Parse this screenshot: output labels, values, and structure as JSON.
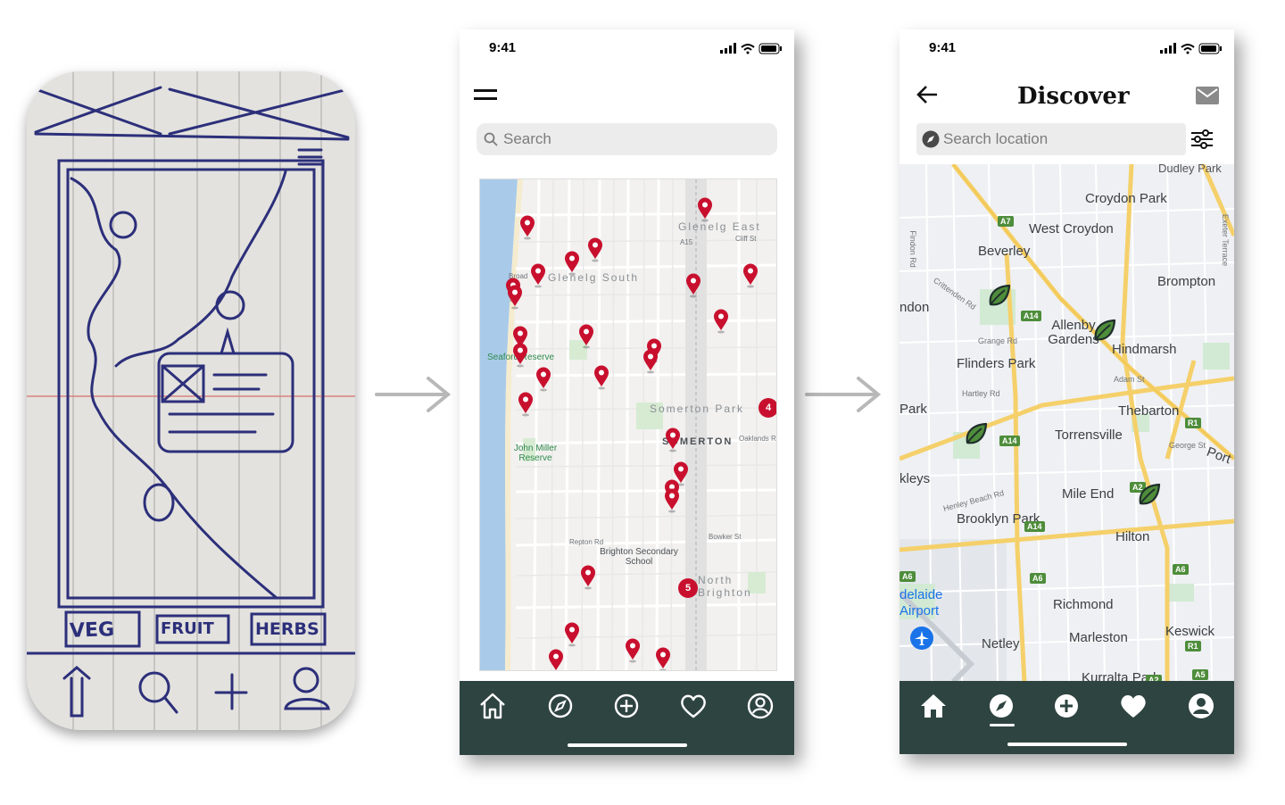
{
  "sketch": {
    "tabs": [
      "VEG",
      "FRUIT",
      "HERBS"
    ]
  },
  "phone2": {
    "status_time": "9:41",
    "search_placeholder": "Search",
    "map_labels": {
      "glenelg_east": "Glenelg East",
      "glenelg_south": "Glenelg South",
      "somerton_park": "Somerton Park",
      "somerton": "SOMERTON",
      "north_brighton": "North Brighton",
      "seaford_reserve": "Seaford Reserve",
      "john_miller_reserve": "John Miller Reserve",
      "brighton_school": "Brighton Secondary School",
      "cliff_st": "Cliff St",
      "oaklands_rd": "Oaklands Rd",
      "bowker_st": "Bowker St",
      "repton_rd": "Repton Rd",
      "broad": "Broad",
      "a15": "A15"
    },
    "clusters": [
      "4",
      "5"
    ],
    "tabs": [
      "home-icon",
      "compass-icon",
      "add-icon",
      "heart-icon",
      "profile-icon"
    ],
    "colors": {
      "pin": "#c8102e",
      "tabbar": "#2e4440"
    }
  },
  "phone3": {
    "status_time": "9:41",
    "title": "Discover",
    "search_placeholder": "Search location",
    "map_labels": {
      "dudley_park": "Dudley Park",
      "croydon_park": "Croydon Park",
      "west_croydon": "West Croydon",
      "beverley": "Beverley",
      "brompton": "Brompton",
      "allenby_gardens": "Allenby Gardens",
      "hindmarsh": "Hindmarsh",
      "flinders_park": "Flinders Park",
      "thebarton": "Thebarton",
      "torrensville": "Torrensville",
      "mile_end": "Mile End",
      "brooklyn_park": "Brooklyn Park",
      "hilton": "Hilton",
      "adelaide_airport": "delaide Airport",
      "richmond": "Richmond",
      "marleston": "Marleston",
      "netley": "Netley",
      "keswick": "Keswick",
      "kurralta_park": "Kurralta Park",
      "ndon": "ndon",
      "park": "Park",
      "kleys": "kleys",
      "port": "Port",
      "grange_rd": "Grange Rd",
      "hartley_rd": "Hartley Rd",
      "adam_st": "Adam St",
      "george_st": "George St",
      "henley_beach_rd": "Henley Beach Rd",
      "crittenden_rd": "Crittenden Rd",
      "findon_rd": "Findon Rd",
      "exeter_terrace": "Exeter Terrace"
    },
    "road_badges": [
      "A7",
      "A14",
      "A14",
      "A14",
      "A2",
      "R1",
      "A6",
      "A6",
      "A6",
      "R1",
      "A5",
      "A2"
    ],
    "tabs": [
      "home-icon",
      "compass-icon",
      "add-icon",
      "heart-icon",
      "profile-icon"
    ],
    "colors": {
      "leaf": "#4e8d3b",
      "tabbar": "#2e4440",
      "road": "#f5d06a"
    }
  }
}
